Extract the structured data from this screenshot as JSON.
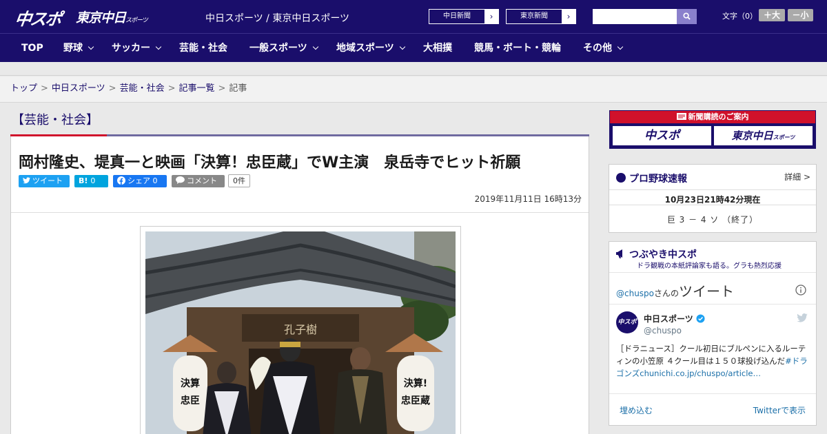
{
  "header": {
    "logo_chuspo": "中スポ",
    "logo_tokyo": "東京中日",
    "logo_tokyo_small": "スポーツ",
    "site_name": "中日スポーツ / 東京中日スポーツ",
    "ext_buttons": [
      {
        "label": "中日新聞",
        "arrow": "›"
      },
      {
        "label": "東京新聞",
        "arrow": "›"
      }
    ],
    "search_placeholder": "",
    "search_icon": "search-icon",
    "font_size_label": "文字（0）",
    "font_larger": "＋大",
    "font_smaller": "－小"
  },
  "nav": {
    "items": [
      {
        "label": "TOP",
        "dropdown": false
      },
      {
        "label": "野球",
        "dropdown": true
      },
      {
        "label": "サッカー",
        "dropdown": true
      },
      {
        "label": "芸能・社会",
        "dropdown": false
      },
      {
        "label": "一般スポーツ",
        "dropdown": true
      },
      {
        "label": "地域スポーツ",
        "dropdown": true
      },
      {
        "label": "大相撲",
        "dropdown": false
      },
      {
        "label": "競馬・ボート・競輪",
        "dropdown": false
      },
      {
        "label": "その他",
        "dropdown": true
      }
    ]
  },
  "breadcrumb": {
    "items": [
      "トップ",
      "中日スポーツ",
      "芸能・社会",
      "記事一覧"
    ],
    "separator": ">",
    "current": "記事"
  },
  "category": {
    "title": "【芸能・社会】"
  },
  "article": {
    "headline": "岡村隆史、堤真一と映画「決算！忠臣蔵」でW主演　泉岳寺でヒット祈願",
    "share": {
      "tweet": "ツイート",
      "hatena": "B!",
      "hatena_count": "0",
      "facebook": "シェア",
      "facebook_count": "0",
      "comment": "コメント",
      "comment_count": "0件"
    },
    "date": "2019年11月11日 16時13分",
    "photo": {
      "plaque": "孔子樹",
      "lantern_left_1": "決算",
      "lantern_left_2": "忠臣",
      "lantern_right_1": "決算!",
      "lantern_right_2": "忠臣蔵"
    }
  },
  "sidebar": {
    "promo": {
      "top": "新聞購読のご案内",
      "btn1": "中スポ",
      "btn2": "東京中日",
      "btn2_small": "スポーツ"
    },
    "baseball": {
      "title": "プロ野球速報",
      "more": "詳細 >",
      "updated": "10月23日21時42分現在",
      "score": "巨 3 － 4 ソ （終了）"
    },
    "tweets": {
      "title": "つぶやき中スポ",
      "subtitle": "ドラ観戦の本紙評論家も語る。グラも熱烈応援",
      "handle_prefix": "@chuspo",
      "handle_suffix": "さんの",
      "tweet_word": "ツイート",
      "account_name": "中日スポーツ",
      "account_handle": "@chuspo",
      "avatar_text": "中スポ",
      "body": "［ドラニュース］クール初日にブルペンに入るルーティンの小笠原 ４クール目は１５０球投げ込んだ",
      "hashtag": "#ドラゴンズ",
      "link": "chunichi.co.jp/chuspo/article…",
      "embed": "埋め込む",
      "view_on": "Twitterで表示"
    }
  },
  "colors": {
    "navy": "#1a0e6b",
    "red": "#d0112b",
    "twitter": "#1da1f2",
    "hatena": "#00a4de",
    "facebook": "#1877f2"
  }
}
